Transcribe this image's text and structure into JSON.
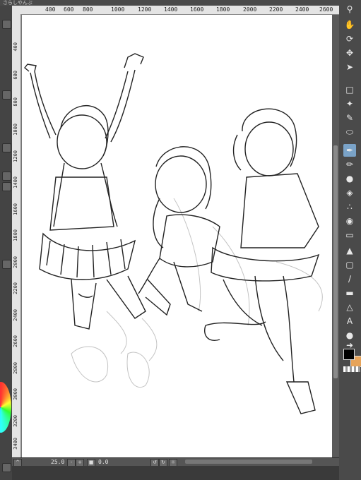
{
  "window": {
    "tab_title": "さらしやんぶ"
  },
  "ruler": {
    "top_ticks": [
      "400",
      "600",
      "800",
      "1000",
      "1200",
      "1400",
      "1600",
      "1800",
      "2000",
      "2200",
      "2400",
      "2600"
    ],
    "left_ticks": [
      "400",
      "600",
      "800",
      "1000",
      "1200",
      "1400",
      "1600",
      "1800",
      "2000",
      "2200",
      "2400",
      "2600",
      "2800",
      "3000",
      "3200",
      "3400"
    ]
  },
  "statusbar": {
    "zoom": "25.0",
    "rotation": "0.0"
  },
  "colors": {
    "main_color": "#000000",
    "sub_color": "#e7a45a",
    "tool_highlight": "#7aa3c8"
  },
  "tools": [
    "zoom-icon",
    "hand-icon",
    "rotate-icon",
    "move-icon",
    "operation-icon",
    "selection-icon",
    "lasso-icon",
    "eyedropper-icon",
    "ellipse-icon",
    "pen-icon",
    "pencil-icon",
    "brush-icon",
    "airbrush-icon",
    "decoration-icon",
    "blend-icon",
    "eraser-icon",
    "fill-icon",
    "gradient-icon",
    "line-icon",
    "frame-icon",
    "ruler-icon",
    "text-icon",
    "balloon-icon",
    "correct-line-icon"
  ]
}
